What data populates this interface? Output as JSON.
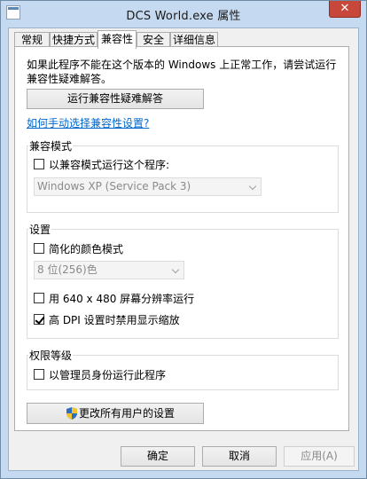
{
  "window": {
    "title": "DCS World.exe 属性",
    "close_label": "✕"
  },
  "tabs": [
    {
      "label": "常规"
    },
    {
      "label": "快捷方式"
    },
    {
      "label": "兼容性"
    },
    {
      "label": "安全"
    },
    {
      "label": "详细信息"
    }
  ],
  "active_tab": "兼容性",
  "intro": {
    "text": "如果此程序不能在这个版本的 Windows 上正常工作，请尝试运行兼容性疑难解答。"
  },
  "troubleshooter_button": "运行兼容性疑难解答",
  "manual_link": "如何手动选择兼容性设置?",
  "compat_mode": {
    "group_label": "兼容模式",
    "checkbox_label": "以兼容模式运行这个程序:",
    "checked": false,
    "os_select_value": "Windows XP (Service Pack 3)"
  },
  "settings": {
    "group_label": "设置",
    "reduced_color_label": "简化的颜色模式",
    "reduced_color_checked": false,
    "color_select_value": "8 位(256)色",
    "res_640_label": "用 640 x 480 屏幕分辨率运行",
    "res_640_checked": false,
    "high_dpi_label": "高 DPI 设置时禁用显示缩放",
    "high_dpi_checked": true
  },
  "privilege": {
    "group_label": "权限等级",
    "admin_label": "以管理员身份运行此程序",
    "admin_checked": false
  },
  "change_all_users_button": "更改所有用户的设置",
  "footer": {
    "ok_label": "确定",
    "cancel_label": "取消",
    "apply_label": "应用(A)"
  },
  "colors": {
    "frame": "#c5daf0",
    "close": "#c7473b",
    "link": "#0066cc"
  }
}
